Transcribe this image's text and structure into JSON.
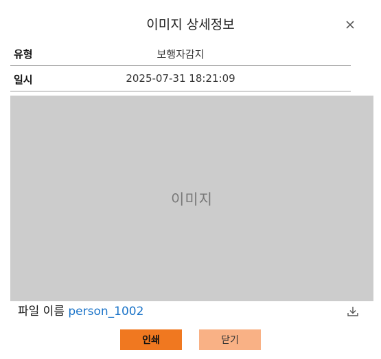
{
  "dialog": {
    "title": "이미지 상세정보"
  },
  "info": {
    "type_label": "유형",
    "type_value": "보행자감지",
    "date_label": "일시",
    "date_value": "2025-07-31 18:21:09"
  },
  "image": {
    "placeholder_text": "이미지"
  },
  "file": {
    "label": "파일 이름",
    "name": "person_1002"
  },
  "buttons": {
    "print_label": "인쇄",
    "close_label": "닫기"
  },
  "colors": {
    "print_button": "#f07820",
    "close_button": "#f9b185",
    "image_background": "#cccccc",
    "file_link": "#1a73c8"
  },
  "icons": {
    "close": "close-icon",
    "download": "download-icon"
  }
}
